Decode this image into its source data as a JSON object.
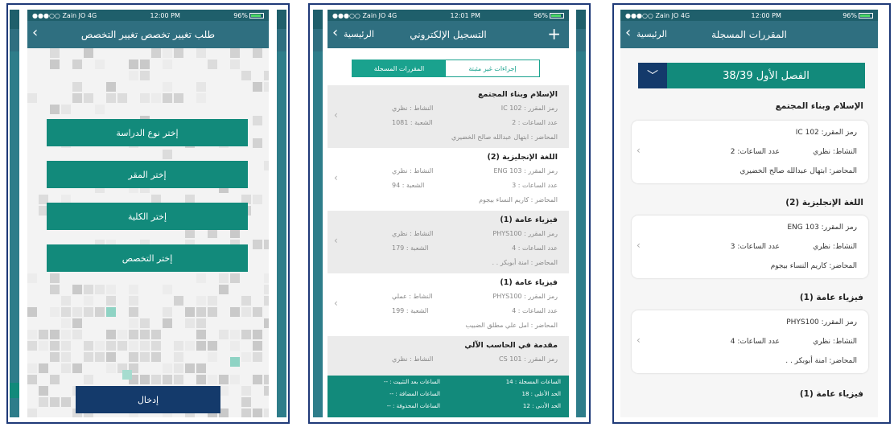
{
  "status": {
    "carrier": "●●●○○ Zain JO  4G",
    "battery": "96%"
  },
  "screen1": {
    "time": "12:00 PM",
    "title": "طلب تغيير تخصص  تغيير التخصص",
    "buttons": [
      "إختر نوع الدراسة",
      "إختر المقر",
      "إختر الكلية",
      "إختر التخصص"
    ],
    "submit": "إدخال"
  },
  "screen2": {
    "time": "12:01 PM",
    "back": "الرئيسية",
    "title": "التسجيل الإلكتروني",
    "plus": "+",
    "tabs": {
      "left": "المقررات المسجلة",
      "right": "إجراءات غير مثبتة"
    },
    "courses": [
      {
        "title": "الإسلام وبناء المجتمع",
        "code": "رمز المقرر :  102  IC",
        "activity": "النشاط : نظري",
        "hours": "عدد الساعات :  2",
        "section": "الشعبة : 1081",
        "lecturer": "المحاضر : ابتهال عبدالله صالح الخضيري"
      },
      {
        "title": "اللغة الإنجليزية (2)",
        "code": "رمز المقرر : ENG 103",
        "activity": "النشاط : نظري",
        "hours": "عدد الساعات :  3",
        "section": "الشعبة : 94",
        "lecturer": "المحاضر : كاريم النساء بيجوم"
      },
      {
        "title": "فيزياء عامة (1)",
        "code": "رمز المقرر : PHYS100",
        "activity": "النشاط : نظري",
        "hours": "عدد الساعات :  4",
        "section": "الشعبة : 179",
        "lecturer": "المحاضر : امنة أبوبكر . ."
      },
      {
        "title": "فيزياء عامة (1)",
        "code": "رمز المقرر : PHYS100",
        "activity": "النشاط : عملي",
        "hours": "عدد الساعات :  4",
        "section": "الشعبة : 199",
        "lecturer": "المحاضر : امل علي مطلق الضبيب"
      },
      {
        "title": "مقدمة في الحاسب الآلي",
        "code": "رمز المقرر : CS 101",
        "activity": "النشاط : نظري",
        "hours": "",
        "section": "",
        "lecturer": ""
      }
    ],
    "footer": {
      "r1": "الساعات المسجلة : 14",
      "r2": "الحد الأعلى : 18",
      "r3": "الحد الأدنى : 12",
      "l1": "الساعات بعد التثبيت : --",
      "l2": "الساعات المضافة : --",
      "l3": "الساعات المحذوفة : --"
    }
  },
  "screen3": {
    "time": "12:00 PM",
    "back": "الرئيسية",
    "title": "المقررات المسجلة",
    "semester": "الفصل الأول 38/39",
    "dropdown": "﹀",
    "courses": [
      {
        "title": "الإسلام وبناء المجتمع",
        "code": "رمز المقرر:  102  IC",
        "activity": "النشاط:  نظري",
        "hours": "عدد الساعات:  2",
        "lecturer": "المحاضر:  ابتهال عبدالله صالح الخضيري"
      },
      {
        "title": "اللغة الإنجليزية (2)",
        "code": "رمز المقرر:  ENG 103",
        "activity": "النشاط:  نظري",
        "hours": "عدد الساعات:  3",
        "lecturer": "المحاضر:  كاريم النساء  بيجوم"
      },
      {
        "title": "فيزياء عامة (1)",
        "code": "رمز المقرر:  PHYS100",
        "activity": "النشاط:  نظري",
        "hours": "عدد الساعات:  4",
        "lecturer": "المحاضر:  امنة أبوبكر . ."
      }
    ],
    "last_heading": "فيزياء عامة (1)"
  }
}
